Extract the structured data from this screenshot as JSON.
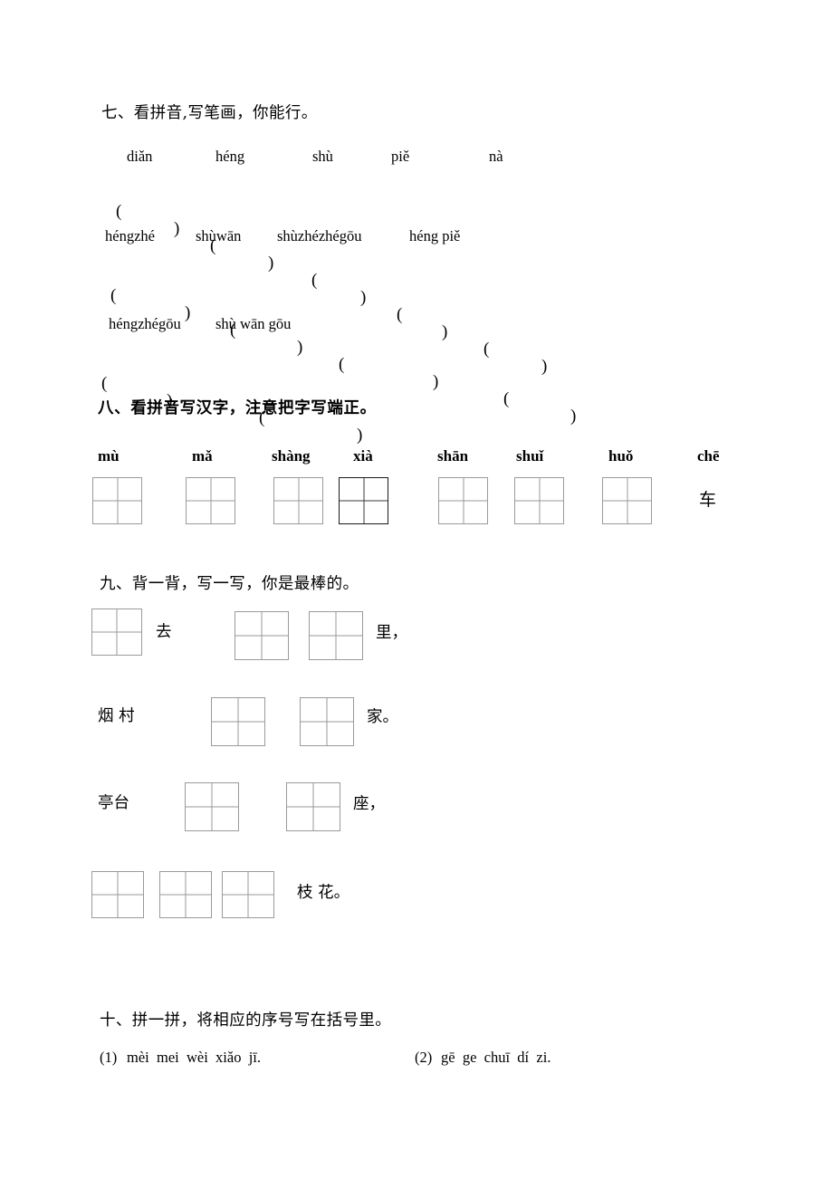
{
  "document": {
    "type": "chinese-primary-worksheet",
    "page_background": "#ffffff",
    "ink_color": "#000000"
  },
  "sections": {
    "seven": {
      "heading": "七、看拼音,写笔画，你能行。",
      "rows": [
        {
          "pinyin": [
            "diǎn",
            "héng",
            "shù",
            "piě",
            "nà"
          ],
          "answer_blanks": 5
        },
        {
          "pinyin": [
            "héngzhé",
            "shùwān",
            "shùzhézhégōu",
            "héng piě"
          ],
          "answer_blanks": 4
        },
        {
          "pinyin": [
            "héngzhégōu",
            "shù wān gōu"
          ],
          "answer_blanks": 2
        }
      ],
      "open_paren": "(",
      "close_paren": ")"
    },
    "eight": {
      "heading": "八、看拼音写汉字，注意把字写端正。",
      "pinyin": [
        "mù",
        "mǎ",
        "shàng",
        "xià",
        "shān",
        "shuǐ",
        "huǒ",
        "chē"
      ],
      "prefilled": {
        "index": 7,
        "character": "车"
      },
      "grid_count": 7
    },
    "nine": {
      "heading": "九、背一背，写一写，你是最棒的。",
      "lines": [
        {
          "segments": [
            {
              "kind": "grid",
              "count": 1
            },
            {
              "kind": "text",
              "value": "去"
            },
            {
              "kind": "grid",
              "count": 2
            },
            {
              "kind": "text",
              "value": "里，"
            }
          ]
        },
        {
          "segments": [
            {
              "kind": "text",
              "value": "烟 村"
            },
            {
              "kind": "grid",
              "count": 2
            },
            {
              "kind": "text",
              "value": "家。"
            }
          ]
        },
        {
          "segments": [
            {
              "kind": "text",
              "value": "亭台"
            },
            {
              "kind": "grid",
              "count": 2
            },
            {
              "kind": "text",
              "value": "座，"
            }
          ]
        },
        {
          "segments": [
            {
              "kind": "grid",
              "count": 3
            },
            {
              "kind": "text",
              "value": "枝 花。"
            }
          ]
        }
      ]
    },
    "ten": {
      "heading": "十、拼一拼，将相应的序号写在括号里。",
      "items": [
        {
          "number": "(1)",
          "pinyin": "mèi  mei  wèi  xiǎo  jī."
        },
        {
          "number": "(2)",
          "pinyin": "gē  ge  chuī  dí  zi."
        }
      ]
    }
  }
}
